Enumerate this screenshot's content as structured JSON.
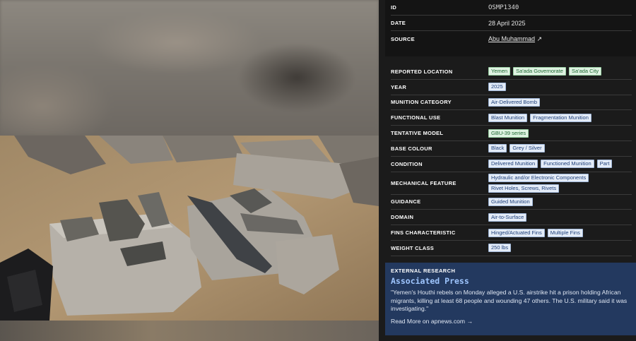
{
  "photo": {
    "alt_icon": "debris-photo"
  },
  "panel": {
    "id": {
      "label": "ID",
      "value": "OSMP1340"
    },
    "date": {
      "label": "DATE",
      "value": "28 April 2025"
    },
    "source": {
      "label": "SOURCE",
      "value": "Abu Muhammad",
      "icon": "external-link-icon",
      "arrow": "↗"
    },
    "attributes": [
      {
        "label": "REPORTED LOCATION",
        "tags": [
          "Yemen",
          "Sa'ada Governorate",
          "Sa'ada City"
        ],
        "color": "green"
      },
      {
        "label": "YEAR",
        "tags": [
          "2025"
        ],
        "color": "blue"
      },
      {
        "label": "MUNITION CATEGORY",
        "tags": [
          "Air-Delivered Bomb"
        ],
        "color": "blue"
      },
      {
        "label": "FUNCTIONAL USE",
        "tags": [
          "Blast Munition",
          "Fragmentation Munition"
        ],
        "color": "blue"
      },
      {
        "label": "TENTATIVE MODEL",
        "tags": [
          "GBU-39 series"
        ],
        "color": "green"
      },
      {
        "label": "BASE COLOUR",
        "tags": [
          "Black",
          "Grey / Silver"
        ],
        "color": "blue"
      },
      {
        "label": "CONDITION",
        "tags": [
          "Delivered Munition",
          "Functioned Munition",
          "Part"
        ],
        "color": "blue"
      },
      {
        "label": "MECHANICAL FEATURE",
        "tags": [
          "Hydraulic and/or Electronic Components",
          "Rivet Holes, Screws, Rivets"
        ],
        "color": "blue"
      },
      {
        "label": "GUIDANCE",
        "tags": [
          "Guided Munition"
        ],
        "color": "blue"
      },
      {
        "label": "DOMAIN",
        "tags": [
          "Air-to-Surface"
        ],
        "color": "blue"
      },
      {
        "label": "FINS CHARACTERISTIC",
        "tags": [
          "Hinged/Actuated Fins",
          "Multiple Fins"
        ],
        "color": "blue"
      },
      {
        "label": "WEIGHT CLASS",
        "tags": [
          "250 lbs"
        ],
        "color": "blue"
      }
    ],
    "research": {
      "heading": "EXTERNAL RESEARCH",
      "outlet": "Associated Press",
      "quote": "\"Yemen's Houthi rebels on Monday alleged a U.S. airstrike hit a prison holding African migrants, killing at least 68 people and wounding 47 others. The U.S. military said it was investigating.\"",
      "link": "Read More on apnews.com →"
    }
  }
}
